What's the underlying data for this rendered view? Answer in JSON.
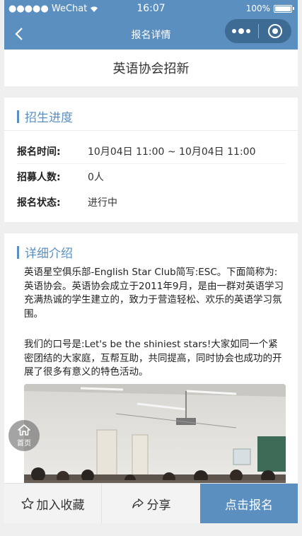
{
  "status_bar": {
    "signal": "●●●●● WeChat",
    "time": "16:07",
    "battery_text": "100%"
  },
  "nav": {
    "title": "报名详情"
  },
  "event": {
    "title": "英语协会招新"
  },
  "progress": {
    "section_title": "招生进度",
    "rows": [
      {
        "key": "报名时间:",
        "value": "10月04日 11:00 ~ 10月04日 11:00"
      },
      {
        "key": "招募人数:",
        "value": "0人"
      },
      {
        "key": "报名状态:",
        "value": "进行中"
      }
    ]
  },
  "detail": {
    "section_title": "详细介绍",
    "paragraph1": "英语星空俱乐部-English Star Club简写:ESC。下面简称为:英语协会。英语协会成立于2011年9月，是由一群对英语学习充满热诚的学生建立的，致力于营造轻松、欢乐的英语学习氛围。",
    "paragraph2": "我们的口号是:Let's be the shiniest stars!大家如同一个紧密团结的大家庭，互帮互助，共同提高，同时协会也成功的开展了很多有意义的特色活动。"
  },
  "float_home": {
    "label": "首页"
  },
  "bottom_bar": {
    "favorite": "加入收藏",
    "share": "分享",
    "signup": "点击报名"
  },
  "colors": {
    "primary": "#5b8fc0"
  }
}
